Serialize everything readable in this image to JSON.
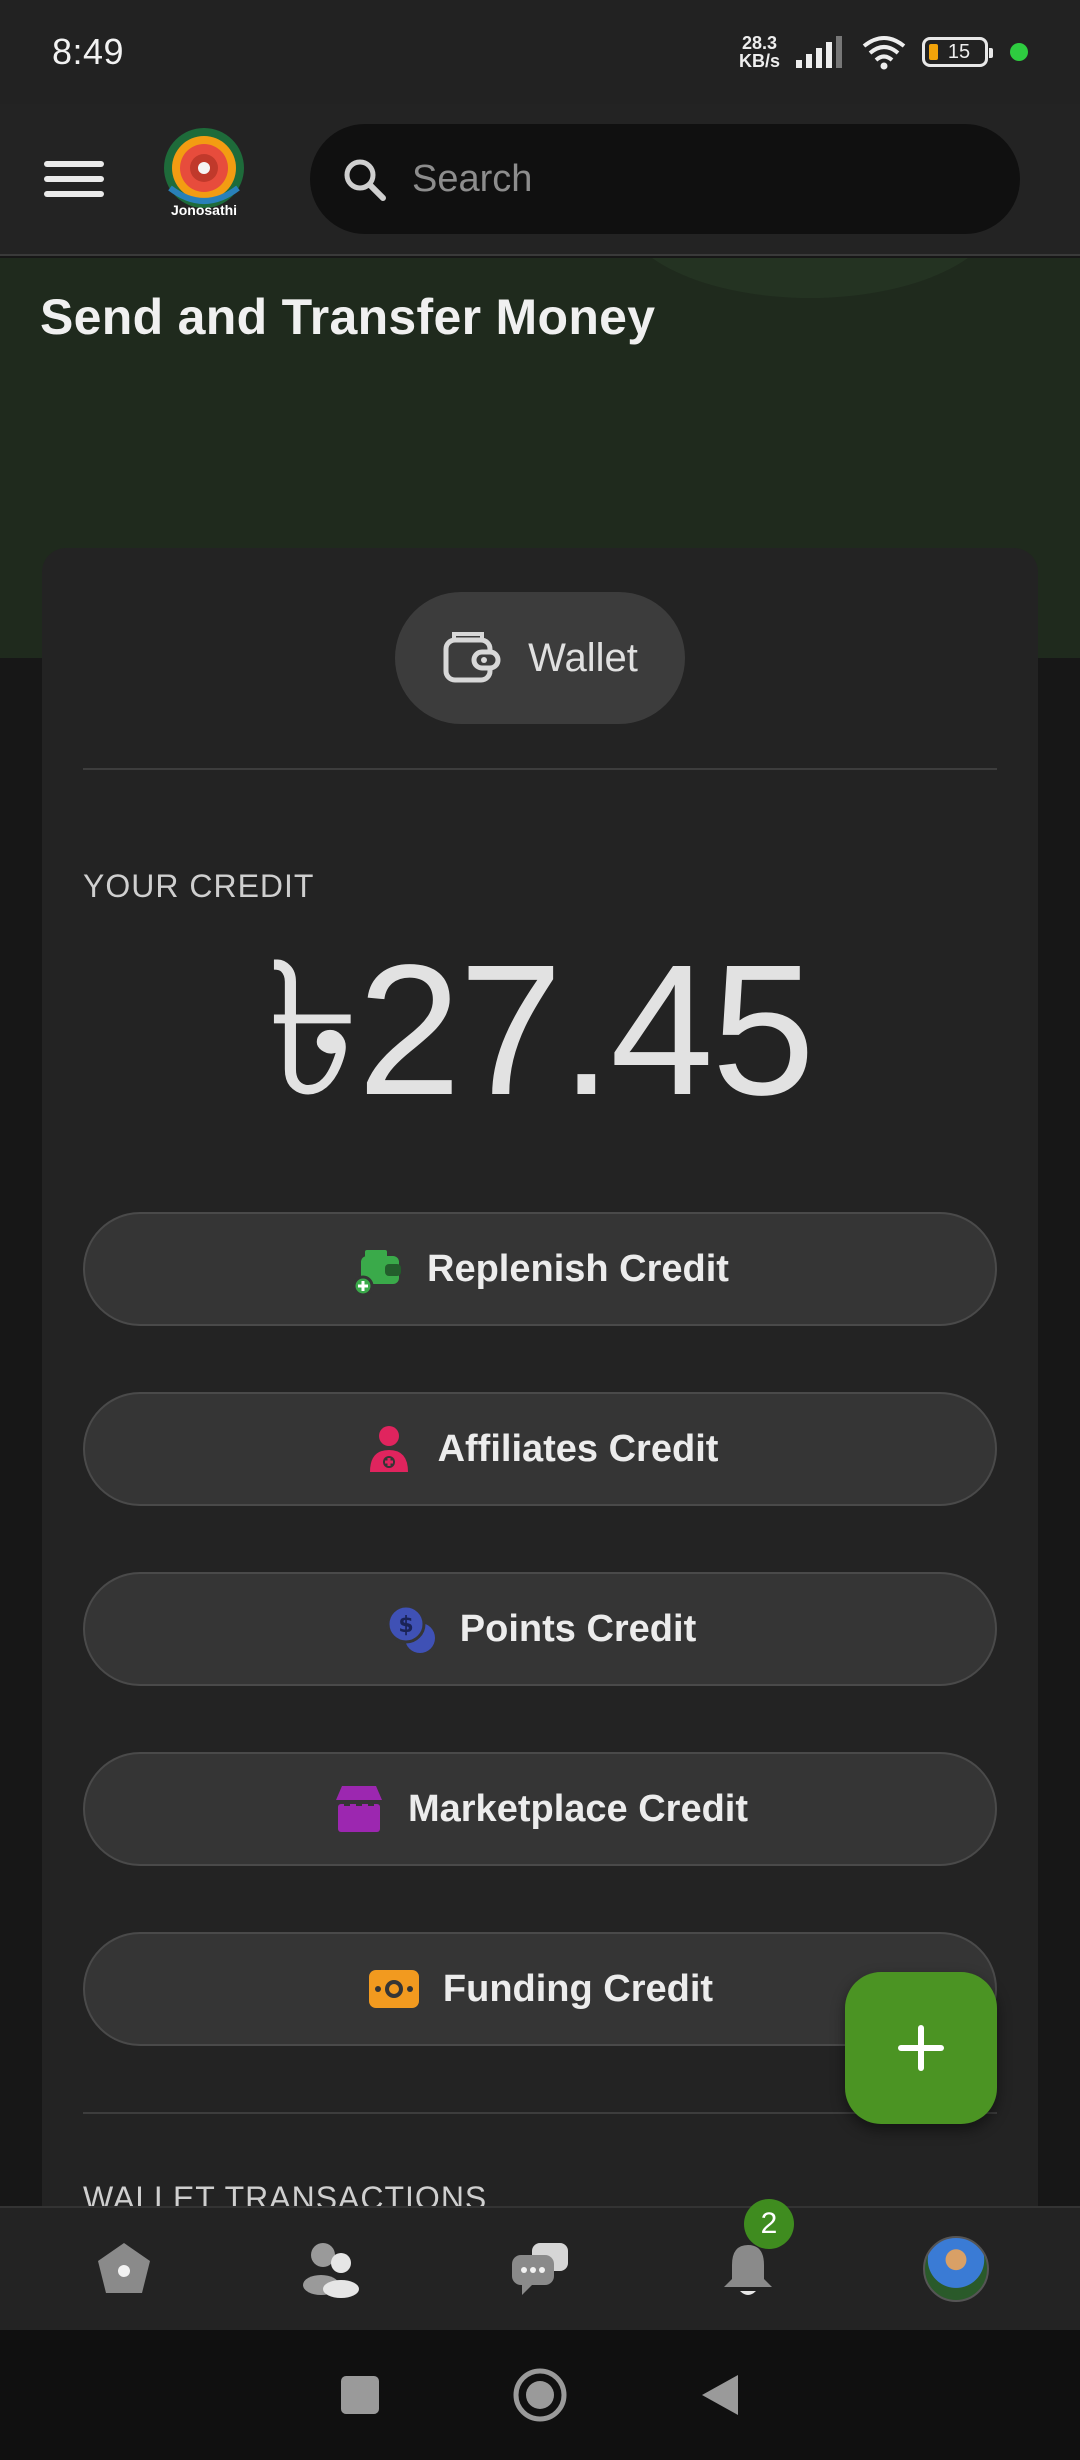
{
  "status_bar": {
    "time": "8:49",
    "net_speed_value": "28.3",
    "net_speed_unit": "KB/s",
    "battery": "15"
  },
  "appbar": {
    "logo_text": "Jonosathi",
    "search_placeholder": "Search"
  },
  "page": {
    "title": "Send and Transfer Money"
  },
  "wallet": {
    "tab_label": "Wallet",
    "credit_label": "YOUR CREDIT",
    "credit_amount": "৳27.45"
  },
  "credit_actions": [
    {
      "label": "Replenish Credit",
      "icon": "wallet-add-icon",
      "color": "#3aaa4a"
    },
    {
      "label": "Affiliates Credit",
      "icon": "user-plus-icon",
      "color": "#e0245e"
    },
    {
      "label": "Points Credit",
      "icon": "coins-icon",
      "color": "#3f51b5"
    },
    {
      "label": "Marketplace Credit",
      "icon": "store-icon",
      "color": "#9c27b0"
    },
    {
      "label": "Funding Credit",
      "icon": "cash-icon",
      "color": "#f29a1f"
    }
  ],
  "transactions": {
    "section_label": "WALLET TRANSACTIONS"
  },
  "fab": {
    "icon": "plus-icon",
    "color": "#4b9423"
  },
  "bottom_nav": {
    "items": [
      {
        "icon": "home-icon"
      },
      {
        "icon": "friends-icon"
      },
      {
        "icon": "messages-icon"
      },
      {
        "icon": "bell-icon",
        "badge": "2"
      },
      {
        "icon": "profile-avatar"
      }
    ]
  }
}
